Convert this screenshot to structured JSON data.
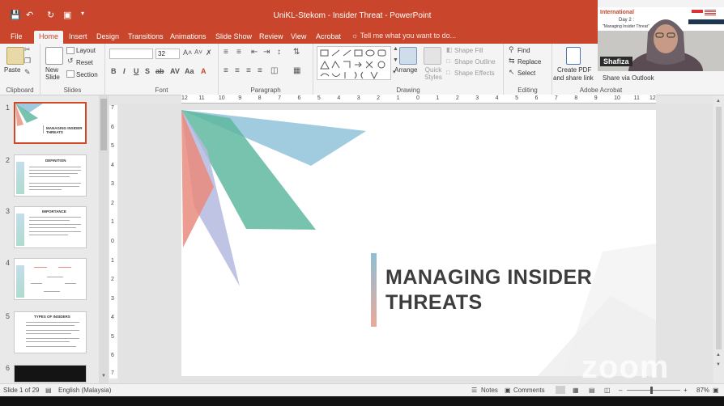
{
  "window": {
    "title": "UniKL-Stekom  -  Insider Threat  -  PowerPoint"
  },
  "tabs": [
    "File",
    "Home",
    "Insert",
    "Design",
    "Transitions",
    "Animations",
    "Slide Show",
    "Review",
    "View",
    "Acrobat"
  ],
  "tell_me": "Tell me what you want to do...",
  "ribbon": {
    "clipboard": {
      "paste": "Paste",
      "label": "Clipboard"
    },
    "slides": {
      "new_slide": "New Slide",
      "layout": "Layout",
      "reset": "Reset",
      "section": "Section",
      "label": "Slides"
    },
    "font": {
      "font_size": "32",
      "label": "Font"
    },
    "paragraph": {
      "label": "Paragraph"
    },
    "drawing": {
      "arrange": "Arrange",
      "quick_styles": "Quick Styles",
      "shape_fill": "Shape Fill",
      "shape_outline": "Shape Outline",
      "shape_effects": "Shape Effects",
      "label": "Drawing"
    },
    "editing": {
      "find": "Find",
      "replace": "Replace",
      "select": "Select",
      "label": "Editing"
    },
    "acrobat": {
      "create_pdf": "Create PDF",
      "share": "and share link",
      "share_outlook": "Share via Outlook",
      "label": "Adobe Acrobat"
    }
  },
  "thumbnails": [
    {
      "num": "1",
      "title": "MANAGING INSIDER THREATS"
    },
    {
      "num": "2",
      "title": "DEFINITION"
    },
    {
      "num": "3",
      "title": "IMPORTANCE"
    },
    {
      "num": "4",
      "title": ""
    },
    {
      "num": "5",
      "title": "TYPES OF INSIDERS"
    },
    {
      "num": "6",
      "title": ""
    }
  ],
  "hruler_ticks": [
    "12",
    "11",
    "10",
    "9",
    "8",
    "7",
    "6",
    "5",
    "4",
    "3",
    "2",
    "1",
    "0",
    "1",
    "2",
    "3",
    "4",
    "5",
    "6",
    "7",
    "8",
    "9",
    "10",
    "11",
    "12"
  ],
  "vruler_ticks": [
    "7",
    "6",
    "5",
    "4",
    "3",
    "2",
    "1",
    "0",
    "1",
    "2",
    "3",
    "4",
    "5",
    "6",
    "7"
  ],
  "slide": {
    "title_line1": "MANAGING INSIDER",
    "title_line2": "THREATS"
  },
  "status": {
    "slide_info": "Slide 1 of 29",
    "language": "English (Malaysia)",
    "notes": "Notes",
    "comments": "Comments",
    "zoom": "87%"
  },
  "video": {
    "speaker": "Shafiza",
    "banner_title": "International",
    "banner_day": "Day 2 :",
    "banner_topic": "\"Managing Insider Threat\""
  },
  "zoom_watermark": "zoom",
  "colors": {
    "accent": "#c9452b",
    "teal": "#5fb8a0",
    "blue": "#86bcd6",
    "lavender": "#b4badf",
    "salmon": "#e98b7c"
  }
}
